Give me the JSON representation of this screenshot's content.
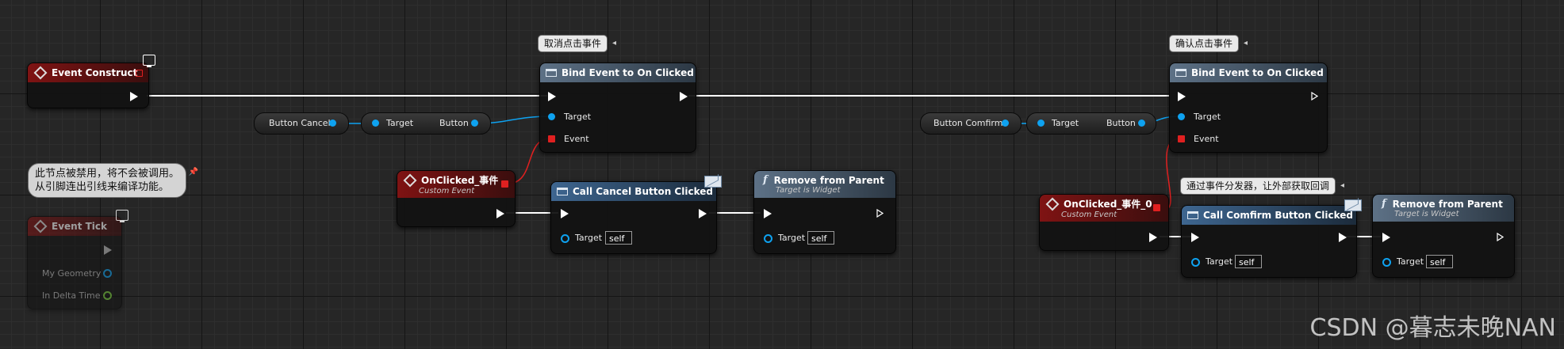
{
  "nodes": {
    "event_construct": {
      "title": "Event Construct"
    },
    "event_tick": {
      "title": "Event Tick",
      "pins": {
        "geometry": "My Geometry",
        "delta": "In Delta Time"
      }
    },
    "disabled_comment": {
      "line1": "此节点被禁用，将不会被调用。",
      "line2": "从引脚连出引线来编译功能。"
    },
    "button_cancel_var": {
      "label": "Button Cancel"
    },
    "get_cancel": {
      "target": "Target",
      "out": "Button"
    },
    "bind_cancel": {
      "title": "Bind Event to On Clicked",
      "comment": "取消点击事件",
      "target": "Target",
      "event": "Event"
    },
    "onclicked_cancel": {
      "title": "OnClicked_事件",
      "subtitle": "Custom Event"
    },
    "call_cancel": {
      "title": "Call Cancel Button Clicked",
      "target": "Target",
      "self": "self"
    },
    "remove_cancel": {
      "title": "Remove from Parent",
      "subtitle": "Target is Widget",
      "target": "Target",
      "self": "self"
    },
    "button_confirm_var": {
      "label": "Button Comfirm"
    },
    "get_confirm": {
      "target": "Target",
      "out": "Button"
    },
    "bind_confirm": {
      "title": "Bind Event to On Clicked",
      "comment": "确认点击事件",
      "target": "Target",
      "event": "Event"
    },
    "onclicked_confirm": {
      "title": "OnClicked_事件_0",
      "subtitle": "Custom Event"
    },
    "call_confirm": {
      "title": "Call Comfirm Button Clicked",
      "comment": "通过事件分发器，让外部获取回调",
      "target": "Target",
      "self": "self"
    },
    "remove_confirm": {
      "title": "Remove from Parent",
      "subtitle": "Target is Widget",
      "target": "Target",
      "self": "self"
    }
  },
  "watermark": "CSDN @暮志未晚NAN",
  "icons": [
    "event-diamond-icon",
    "function-icon",
    "monitor-icon",
    "envelope-icon",
    "pin-icon"
  ],
  "colors": {
    "exec_wire": "#ffffff",
    "object_wire": "#0ea2f0",
    "delegate_wire": "#e02020",
    "event_header": "#7f1313",
    "function_header": "#5d7186"
  }
}
